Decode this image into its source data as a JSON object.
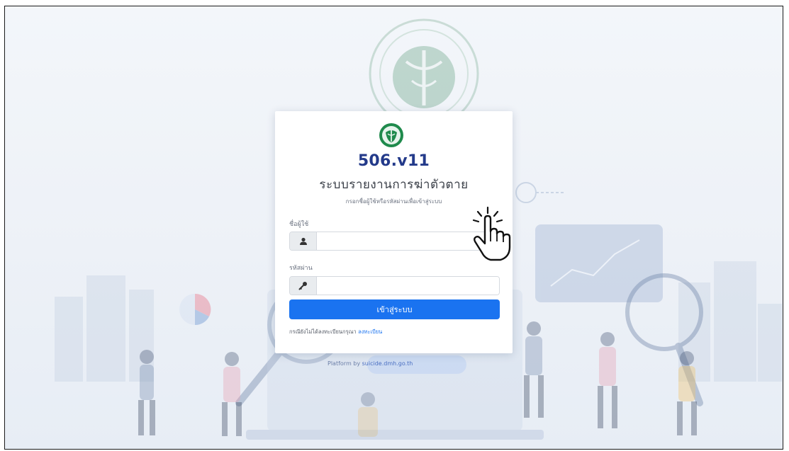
{
  "app": {
    "version_title": "506.v11",
    "system_name": "ระบบรายงานการฆ่าตัวตาย",
    "description": "กรอกชื่อผู้ใช้หรือรหัสผ่านเพื่อเข้าสู่ระบบ"
  },
  "login_form": {
    "username_label": "ชื่อผู้ใช้",
    "username_value": "",
    "password_label": "รหัสผ่าน",
    "password_value": "",
    "submit_label": "เข้าสู่ระบบ",
    "register_prompt": "กรณียังไม่ได้ลงทะเบียนกรุณา",
    "register_link": "ลงทะเบียน"
  },
  "footer": {
    "platform_prefix": "Platform by",
    "platform_domain": "suicide.dmh.go.th"
  },
  "icons": {
    "username_addon": "user-icon",
    "password_addon": "key-icon",
    "logo": "ministry-of-public-health-logo",
    "cursor": "hand-pointer-icon"
  },
  "colors": {
    "title": "#233a8a",
    "primary_button": "#1a73f0",
    "logo_green": "#1f8a4c",
    "background": "#edf1f7"
  }
}
